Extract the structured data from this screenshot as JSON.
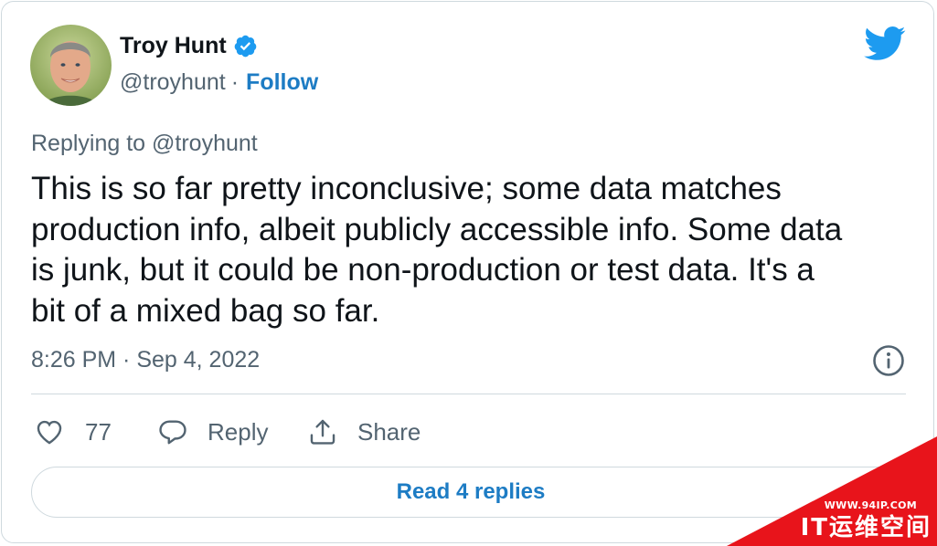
{
  "author": {
    "name": "Troy Hunt",
    "handle": "@troyhunt",
    "separator": "·",
    "follow_label": "Follow"
  },
  "tweet": {
    "replying_to": "Replying to @troyhunt",
    "text": "This is so far pretty inconclusive; some data matches\nproduction info, albeit publicly accessible info. Some data\nis junk, but it could be non-production or test data. It's a\nbit of a mixed bag so far.",
    "timestamp": "8:26 PM · Sep 4, 2022"
  },
  "actions": {
    "like_count": "77",
    "reply_label": "Reply",
    "share_label": "Share"
  },
  "read_replies_label": "Read 4 replies",
  "watermark": {
    "url": "WWW.94IP.COM",
    "brand": "IT运维空间"
  },
  "colors": {
    "link": "#1d7cc4",
    "twitter_blue": "#1d9bf0",
    "secondary_text": "#536471",
    "border": "#cfd9de",
    "watermark_red": "#e8141b"
  },
  "icons": [
    "avatar",
    "verified-badge-icon",
    "twitter-bird-icon",
    "info-icon",
    "heart-icon",
    "reply-bubble-icon",
    "share-icon"
  ]
}
